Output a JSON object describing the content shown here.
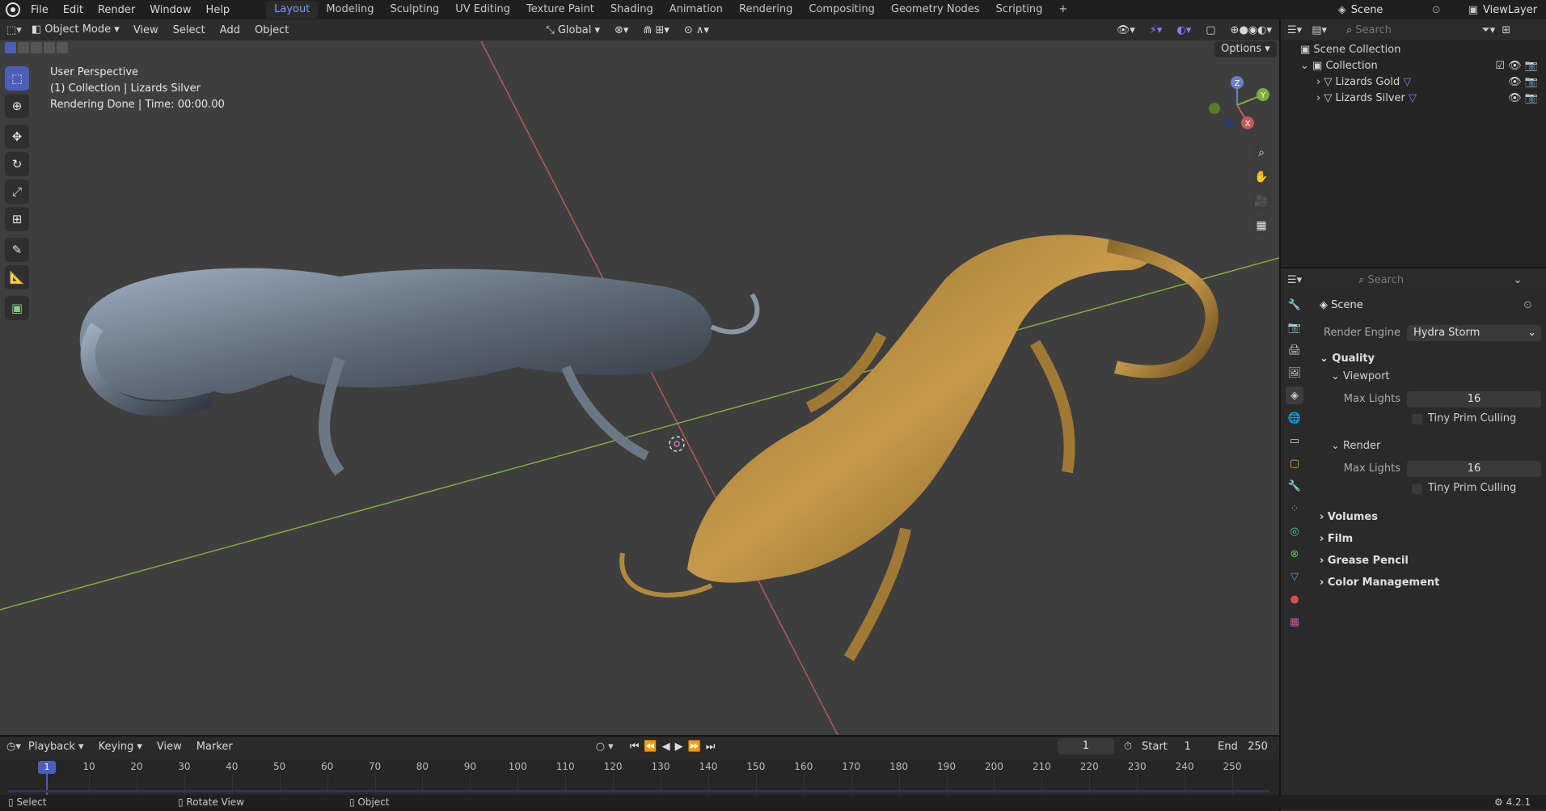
{
  "top_menu": [
    "File",
    "Edit",
    "Render",
    "Window",
    "Help"
  ],
  "workspaces": [
    "Layout",
    "Modeling",
    "Sculpting",
    "UV Editing",
    "Texture Paint",
    "Shading",
    "Animation",
    "Rendering",
    "Compositing",
    "Geometry Nodes",
    "Scripting"
  ],
  "active_workspace": "Layout",
  "scene_name": "Scene",
  "view_layer": "ViewLayer",
  "viewport": {
    "mode": "Object Mode",
    "menus": [
      "View",
      "Select",
      "Add",
      "Object"
    ],
    "transform_orientation": "Global",
    "options_label": "Options",
    "overlay_lines": [
      "User Perspective",
      "(1) Collection | Lizards Silver",
      "Rendering Done | Time: 00:00.00"
    ],
    "gizmo_axes": [
      "Z",
      "Y",
      "X"
    ]
  },
  "outliner": {
    "search_placeholder": "Search",
    "root": "Scene Collection",
    "collection": "Collection",
    "objects": [
      "Lizards Gold",
      "Lizards Silver"
    ]
  },
  "properties": {
    "search_placeholder": "Search",
    "context": "Scene",
    "render_engine_label": "Render Engine",
    "render_engine": "Hydra Storm",
    "quality": "Quality",
    "viewport": "Viewport",
    "max_lights_label": "Max Lights",
    "viewport_max_lights": "16",
    "tiny_prim_culling": "Tiny Prim Culling",
    "render": "Render",
    "render_max_lights": "16",
    "sections": [
      "Volumes",
      "Film",
      "Grease Pencil",
      "Color Management"
    ]
  },
  "timeline": {
    "menus": [
      "Playback",
      "Keying",
      "View",
      "Marker"
    ],
    "current_frame": "1",
    "start_label": "Start",
    "start": "1",
    "end_label": "End",
    "end": "250",
    "ticks": [
      "1",
      "10",
      "20",
      "30",
      "40",
      "50",
      "60",
      "70",
      "80",
      "90",
      "100",
      "110",
      "120",
      "130",
      "140",
      "150",
      "160",
      "170",
      "180",
      "190",
      "200",
      "210",
      "220",
      "230",
      "240",
      "250"
    ]
  },
  "status": {
    "select": "Select",
    "rotate": "Rotate View",
    "object": "Object",
    "version": "4.2.1"
  },
  "colors": {
    "accent": "#4a5fb8",
    "active_tab": "#7b9bff",
    "axis_x": "#c35a5a",
    "axis_y": "#7fae3c",
    "gold": "#b08a3c",
    "silver": "#8a97a3"
  }
}
